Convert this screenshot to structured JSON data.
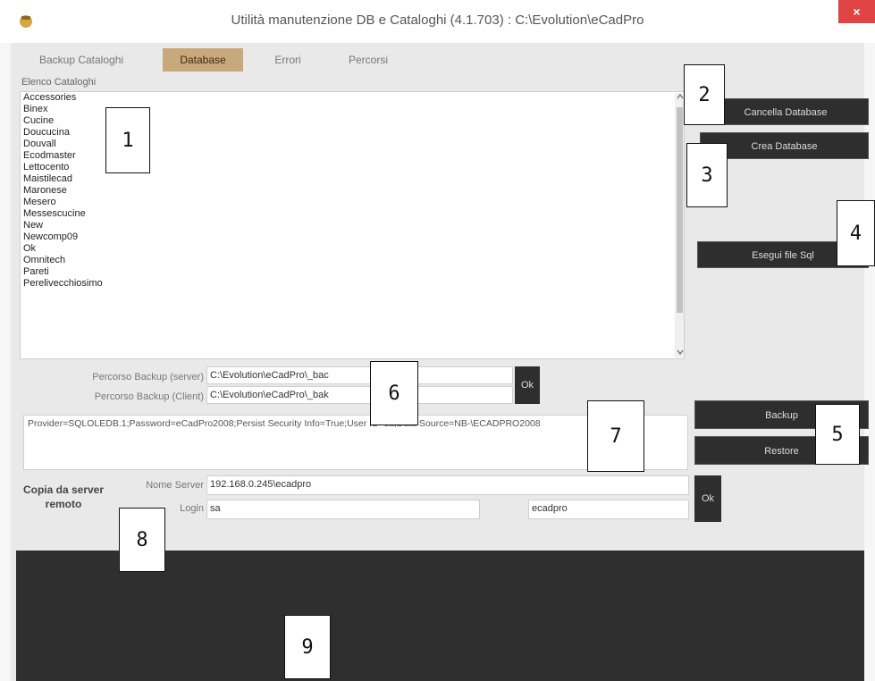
{
  "window": {
    "title": "Utilità manutenzione DB e Cataloghi  (4.1.703) : C:\\Evolution\\eCadPro",
    "close_symbol": "×"
  },
  "tabs": [
    {
      "label": "Backup Cataloghi"
    },
    {
      "label": "Database"
    },
    {
      "label": "Errori"
    },
    {
      "label": "Percorsi"
    }
  ],
  "catalog_list": {
    "label": "Elenco Cataloghi",
    "items": [
      "Accessories",
      "Binex",
      "Cucine",
      "Doucucina",
      "Douvall",
      "Ecodmaster",
      "Lettocento",
      "Maistilecad",
      "Maronese",
      "Mesero",
      "Messescucine",
      "New",
      "Newcomp09",
      "Ok",
      "Omnitech",
      "Pareti",
      "Perelivecchiosimo"
    ]
  },
  "buttons": {
    "cancella": "Cancella Database",
    "crea": "Crea Database",
    "esegui": "Esegui file Sql",
    "backup": "Backup",
    "restore": "Restore",
    "ok1": "Ok",
    "ok2": "Ok"
  },
  "paths": {
    "server_label": "Percorso Backup (server)",
    "server_value": "C:\\Evolution\\eCadPro\\_bac",
    "client_label": "Percorso Backup (Client)",
    "client_value": "C:\\Evolution\\eCadPro\\_bak"
  },
  "connection_string": "Provider=SQLOLEDB.1;Password=eCadPro2008;Persist Security Info=True;User ID=sa;Data Source=NB-\\ECADPRO2008",
  "remote": {
    "title": "Copia da server remoto",
    "server_label": "Nome Server",
    "server_value": "192.168.0.245\\ecadpro",
    "login_label": "Login",
    "login_value": "sa",
    "password_value": "ecadpro"
  },
  "callouts": [
    "1",
    "2",
    "3",
    "4",
    "5",
    "6",
    "7",
    "8",
    "9"
  ]
}
